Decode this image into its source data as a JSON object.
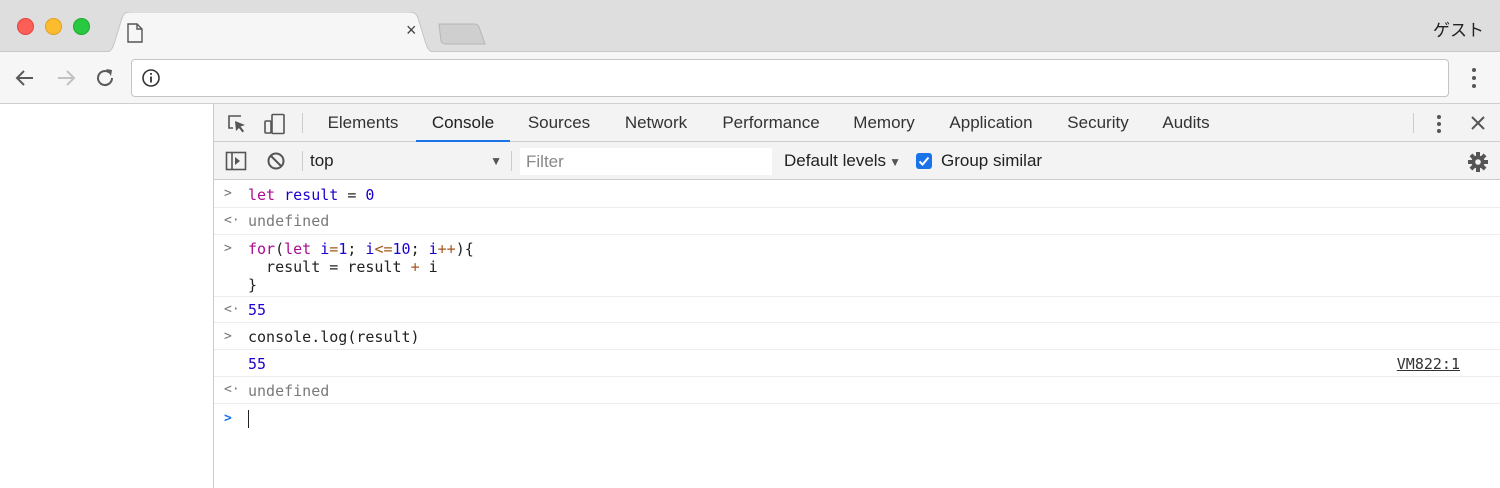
{
  "window": {
    "guest_label": "ゲスト",
    "tab_close": "×"
  },
  "devtools": {
    "tabs": [
      "Elements",
      "Console",
      "Sources",
      "Network",
      "Performance",
      "Memory",
      "Application",
      "Security",
      "Audits"
    ],
    "active_tab": "Console",
    "close_icon": "✕"
  },
  "console_toolbar": {
    "context": "top",
    "filter_placeholder": "Filter",
    "levels": "Default levels",
    "group_similar": "Group similar",
    "group_similar_checked": true
  },
  "console": {
    "entries": [
      {
        "kind": "input",
        "text": "let result = 0"
      },
      {
        "kind": "result",
        "text": "undefined"
      },
      {
        "kind": "input",
        "text": "for(let i=1; i<=10; i++){\n  result = result + i\n}"
      },
      {
        "kind": "result",
        "text": "55"
      },
      {
        "kind": "input",
        "text": "console.log(result)"
      },
      {
        "kind": "log",
        "text": "55",
        "source": "VM822:1"
      },
      {
        "kind": "result",
        "text": "undefined"
      }
    ]
  },
  "colors": {
    "accent": "#1a73e8",
    "keyword": "#aa0d91",
    "number": "#1c00cf",
    "undefined": "#7a7a7a"
  }
}
